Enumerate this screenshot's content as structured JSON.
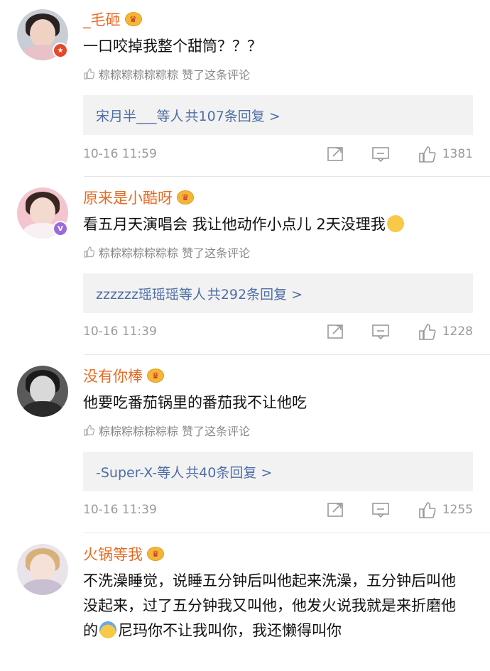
{
  "comments": [
    {
      "username": "_毛砸",
      "text": "一口咬掉我整个甜筒？？？",
      "liked_by": "粽粽粽粽粽粽粽 赞了这条评论",
      "reply_users": "宋月半___等人",
      "reply_count": "共107条回复 >",
      "time": "10-16 11:59",
      "likes": "1381"
    },
    {
      "username": "原来是小酷呀",
      "text": "看五月天演唱会 我让他动作小点儿 2天没理我",
      "liked_by": "粽粽粽粽粽粽粽 赞了这条评论",
      "reply_users": "zzzzzz瑶瑶瑶等人",
      "reply_count": "共292条回复 >",
      "time": "10-16 11:39",
      "likes": "1228"
    },
    {
      "username": "没有你棒",
      "text": "他要吃番茄锅里的番茄我不让他吃",
      "liked_by": "粽粽粽粽粽粽粽 赞了这条评论",
      "reply_users": "-Super-X-等人",
      "reply_count": "共40条回复 >",
      "time": "10-16 11:39",
      "likes": "1255"
    },
    {
      "username": "火锅等我",
      "text_part1": "不洗澡睡觉，说睡五分钟后叫他起来洗澡，五分钟后叫他没起来，过了五分钟我又叫他，他发火说我就是来折磨他的",
      "text_part2": "尼玛你不让我叫你，我还懒得叫你"
    }
  ],
  "icons": {
    "crown": "crown-badge-icon",
    "thumb": "thumb-up-icon",
    "share": "share-icon",
    "comment": "comment-icon"
  },
  "colors": {
    "username": "#e86b24",
    "reply_link": "#4e6fa6",
    "muted": "#999999",
    "reply_bg": "#f2f2f2"
  }
}
